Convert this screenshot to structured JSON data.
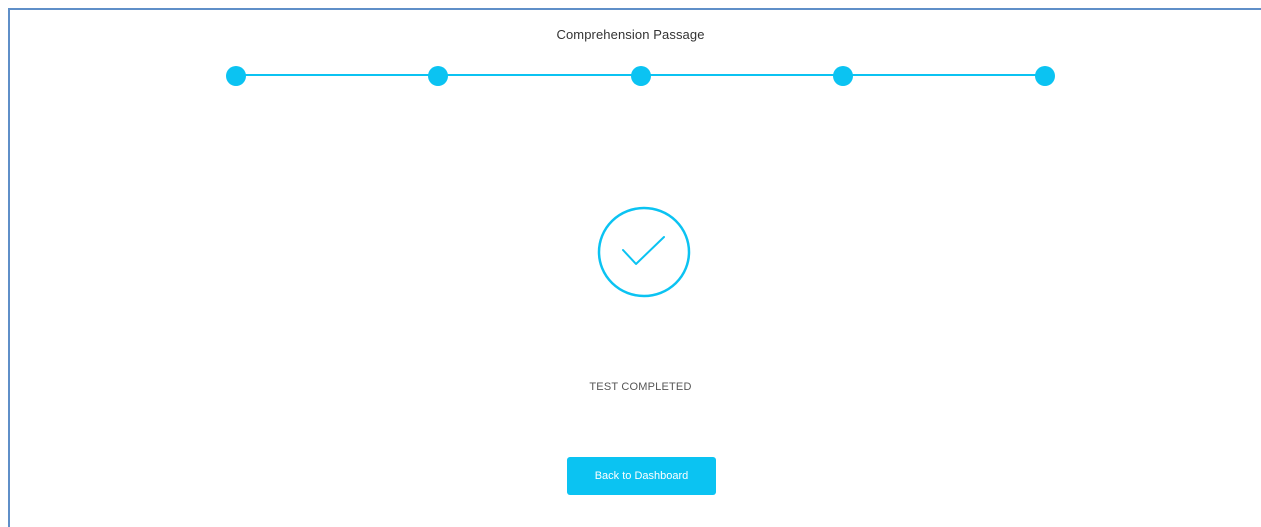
{
  "header": {
    "title": "Comprehension Passage"
  },
  "progress": {
    "total_steps": 5,
    "completed_steps": 5,
    "accent_color": "#0bc3f2"
  },
  "result": {
    "icon": "check-circle-icon",
    "status": "TEST COMPLETED"
  },
  "actions": {
    "back_label": "Back to Dashboard"
  }
}
